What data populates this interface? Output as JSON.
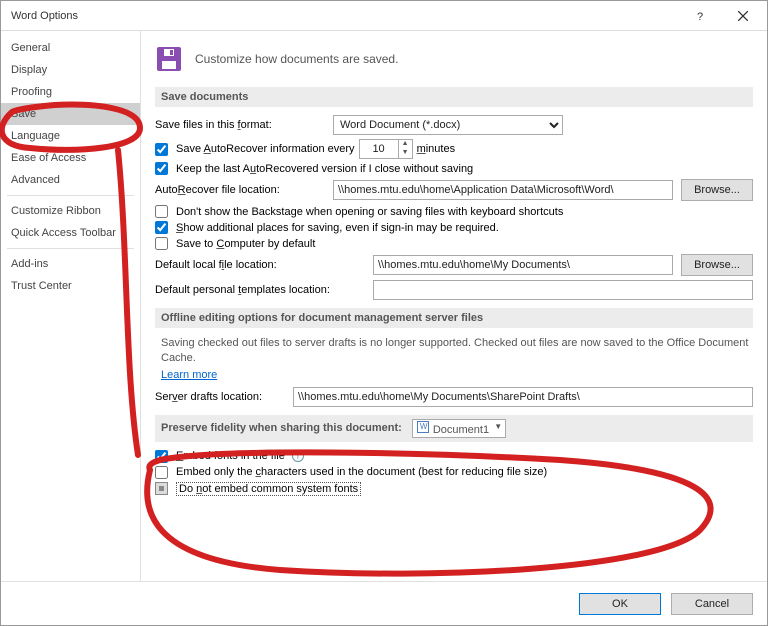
{
  "title": "Word Options",
  "sidebar": {
    "items": [
      "General",
      "Display",
      "Proofing",
      "Save",
      "Language",
      "Ease of Access",
      "Advanced"
    ],
    "items2": [
      "Customize Ribbon",
      "Quick Access Toolbar"
    ],
    "items3": [
      "Add-ins",
      "Trust Center"
    ],
    "selected": "Save"
  },
  "header_text": "Customize how documents are saved.",
  "sections": {
    "save_docs": "Save documents",
    "offline": "Offline editing options for document management server files",
    "preserve": "Preserve fidelity when sharing this document:"
  },
  "save": {
    "format_label": "Save files in this format:",
    "format_value": "Word Document (*.docx)",
    "autorecover_label_pre": "Save ",
    "autorecover_label_mid": "AutoRecover information every",
    "autorecover_minutes": "10",
    "minutes_label": "minutes",
    "keep_last_label": "Keep the last AutoRecovered version if I close without saving",
    "ar_loc_label": "AutoRecover file location:",
    "ar_loc_value": "\\\\homes.mtu.edu\\home\\Application Data\\Microsoft\\Word\\",
    "browse": "Browse...",
    "dont_show_label": "Don't show the Backstage when opening or saving files with keyboard shortcuts",
    "additional_label": "Show additional places for saving, even if sign-in may be required.",
    "save_computer_label": "Save to Computer by default",
    "default_loc_label": "Default local file location:",
    "default_loc_value": "\\\\homes.mtu.edu\\home\\My Documents\\",
    "templates_label": "Default personal templates location:",
    "templates_value": ""
  },
  "offline": {
    "text": "Saving checked out files to server drafts is no longer supported. Checked out files are now saved to the Office Document Cache.",
    "learn_more": "Learn more",
    "drafts_label": "Server drafts location:",
    "drafts_value": "\\\\homes.mtu.edu\\home\\My Documents\\SharePoint Drafts\\"
  },
  "preserve": {
    "doc_value": "Document1",
    "embed_fonts": "Embed fonts in the file",
    "embed_only_chars": "Embed only the characters used in the document (best for reducing file size)",
    "no_common": "Do not embed common system fonts"
  },
  "footer": {
    "ok": "OK",
    "cancel": "Cancel"
  }
}
